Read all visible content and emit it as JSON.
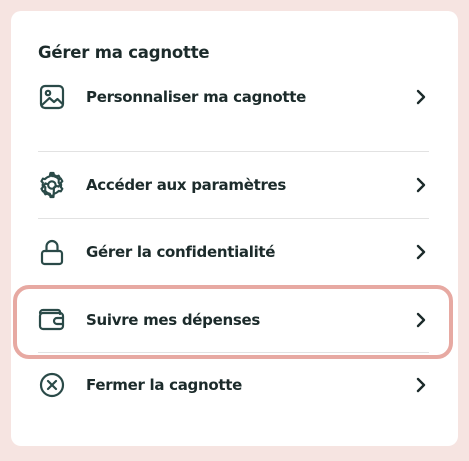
{
  "panel": {
    "title": "Gérer ma cagnotte"
  },
  "menu": {
    "items": [
      {
        "label": "Personnaliser ma cagnotte",
        "icon": "image-icon"
      },
      {
        "label": "Accéder aux paramètres",
        "icon": "gear-icon"
      },
      {
        "label": "Gérer la confidentialité",
        "icon": "lock-icon"
      },
      {
        "label": "Suivre mes dépenses",
        "icon": "wallet-icon",
        "highlighted": true
      },
      {
        "label": "Fermer la cagnotte",
        "icon": "close-circle-icon"
      }
    ]
  },
  "colors": {
    "icon": "#2a4a48",
    "text": "#1c2b2b",
    "background": "#f6e4e1",
    "highlight": "#e7a9a2",
    "divider": "#e2e2e2"
  }
}
